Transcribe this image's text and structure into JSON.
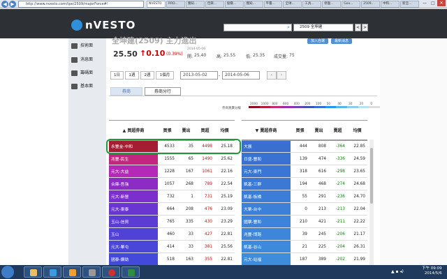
{
  "browser": {
    "url": "http://www.nvesto.com/tpe/2509/majorForce#!",
    "tabs": [
      "NVESTO",
      "RRD...",
      "獲知...",
      "佳興...",
      "股價...",
      "獲知...",
      "平臺...",
      "全球...",
      "工具...",
      "修盤...",
      "Goo...",
      "2509...",
      "中和...",
      "新亞..."
    ],
    "back": "◀",
    "forward": "▶",
    "min": "—",
    "max": "□",
    "close": "✕"
  },
  "header": {
    "logo": "nVESTO",
    "search_placeholder": "",
    "search_icon": "⌕",
    "stock_select": "2509 全坤建",
    "prev": "<",
    "next": ">",
    "btn1": "加入自選",
    "btn2": "最新消息"
  },
  "sidebar": {
    "items": [
      {
        "label": "技術面",
        "icon": "chart-icon"
      },
      {
        "label": "消息面",
        "icon": "news-icon"
      },
      {
        "label": "籌碼面",
        "icon": "chip-icon"
      },
      {
        "label": "基本面",
        "icon": "fundamental-icon"
      }
    ]
  },
  "stock": {
    "title": "全坤建(2509) 主力進出",
    "price": "25.50",
    "change": "↑0.10",
    "change_pct": "(0.39%)",
    "date": "2014-05-06",
    "open_label": "開:",
    "open": "25.40",
    "high_label": "高:",
    "high": "25.55",
    "low_label": "低:",
    "low": "25.35",
    "vol_label": "成交量:",
    "vol": "75"
  },
  "range": {
    "buttons": [
      "1日",
      "1週",
      "2週",
      "1個月"
    ],
    "from": "2013-05-02",
    "to": "2014-05-06",
    "sep": "-",
    "prev": "‹",
    "next": "›"
  },
  "panel_tabs": [
    "券商",
    "券商分行"
  ],
  "legend": {
    "label": "券商買賣分級",
    "ticks": [
      "2000",
      "1000",
      "800",
      "600",
      "400",
      "200",
      "100",
      "50",
      "40",
      "30",
      "20",
      "0"
    ],
    "colors": [
      "#8a1020",
      "#b41a3a",
      "#c0287a",
      "#9c27b0",
      "#6a3fb8",
      "#3f51b5",
      "#2f70d0",
      "#2196f3",
      "#55b4e8",
      "#89cde8",
      "#b8e2f0",
      "#ddd"
    ]
  },
  "buy_table": {
    "headers": [
      "▲ 買超券商",
      "買張",
      "賣出",
      "買超",
      "均價"
    ],
    "rows": [
      {
        "name": "永豐金-中和",
        "buy": "4533",
        "sell": "35",
        "net": "4498",
        "avg": "25.18",
        "color": "#a41d32"
      },
      {
        "name": "兆豐-民生",
        "buy": "1555",
        "sell": "65",
        "net": "1490",
        "avg": "25.62",
        "color": "#c2267e"
      },
      {
        "name": "元大-大益",
        "buy": "1228",
        "sell": "167",
        "net": "1061",
        "avg": "22.16",
        "color": "#b42ab6"
      },
      {
        "name": "合庫-吾強",
        "buy": "1057",
        "sell": "268",
        "net": "789",
        "avg": "22.54",
        "color": "#8c2cc4"
      },
      {
        "name": "元大-新營",
        "buy": "732",
        "sell": "1",
        "net": "731",
        "avg": "25.19",
        "color": "#7b2fcc"
      },
      {
        "name": "元大-東泰",
        "buy": "664",
        "sell": "208",
        "net": "476",
        "avg": "23.09",
        "color": "#6a35d0"
      },
      {
        "name": "玉山-信資",
        "buy": "765",
        "sell": "335",
        "net": "430",
        "avg": "23.29",
        "color": "#5b3dd4"
      },
      {
        "name": "玉山",
        "buy": "460",
        "sell": "33",
        "net": "427",
        "avg": "22.81",
        "color": "#5042d6"
      },
      {
        "name": "元大-華屯",
        "buy": "414",
        "sell": "33",
        "net": "381",
        "sell2": "",
        "avg": "25.56",
        "color": "#4a46d8"
      },
      {
        "name": "國泰-鑽勁",
        "buy": "518",
        "sell": "163",
        "net": "355",
        "avg": "22.81",
        "color": "#4349da"
      }
    ]
  },
  "sell_table": {
    "headers": [
      "▼ 賣超券商",
      "買張",
      "賣出",
      "賣超",
      "均價"
    ],
    "rows": [
      {
        "name": "大展",
        "buy": "444",
        "sell": "808",
        "net": "-364",
        "avg": "22.85",
        "color": "#3a6fd0"
      },
      {
        "name": "日盛-豐和",
        "buy": "139",
        "sell": "474",
        "net": "-336",
        "avg": "24.59",
        "color": "#3a72d2"
      },
      {
        "name": "元大-東門",
        "buy": "318",
        "sell": "616",
        "net": "-298",
        "avg": "23.65",
        "color": "#3a76d4"
      },
      {
        "name": "凱基-三群",
        "buy": "194",
        "sell": "468",
        "net": "-274",
        "avg": "24.68",
        "color": "#3b79d5"
      },
      {
        "name": "凱基-板橋",
        "buy": "55",
        "sell": "291",
        "net": "-236",
        "avg": "24.70",
        "color": "#3b7dd7"
      },
      {
        "name": "大華-台中",
        "buy": "0",
        "sell": "213",
        "net": "-213",
        "avg": "22.04",
        "color": "#3c80d8"
      },
      {
        "name": "國票-豐和",
        "buy": "210",
        "sell": "421",
        "net": "-211",
        "avg": "22.22",
        "color": "#3c83d9"
      },
      {
        "name": "兆豐-博路",
        "buy": "39",
        "sell": "245",
        "net": "-206",
        "avg": "21.17",
        "color": "#3d86da"
      },
      {
        "name": "凱基-谷山",
        "buy": "21",
        "sell": "225",
        "net": "-204",
        "avg": "26.31",
        "color": "#3d89db"
      },
      {
        "name": "元大-站福",
        "buy": "187",
        "sell": "389",
        "net": "-202",
        "avg": "21.99",
        "color": "#3e8cdc"
      }
    ]
  },
  "taskbar": {
    "time": "下午 09:09",
    "date": "2014/5/6"
  }
}
